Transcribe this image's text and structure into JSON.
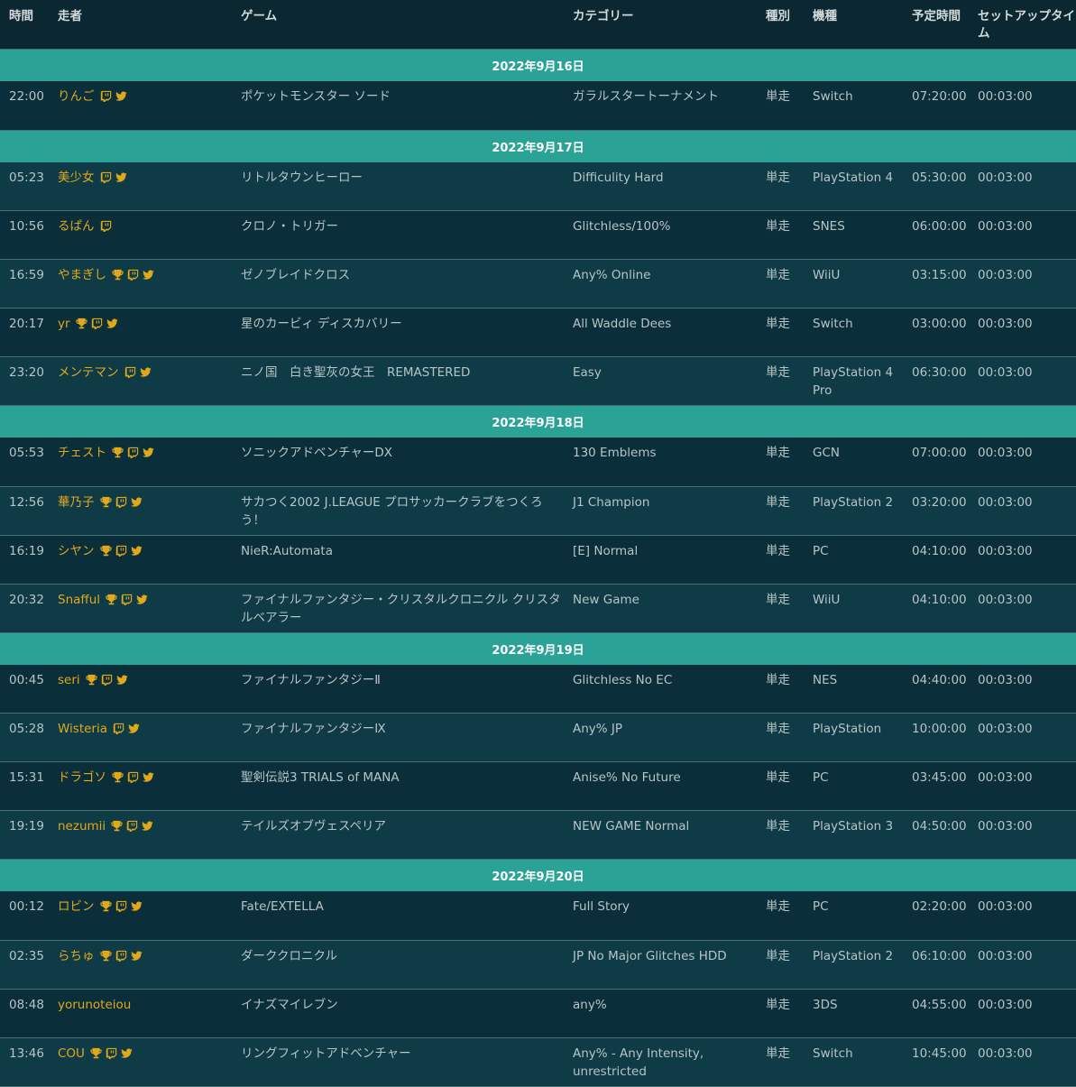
{
  "headers": {
    "time": "時間",
    "runner": "走者",
    "game": "ゲーム",
    "category": "カテゴリー",
    "type": "種別",
    "platform": "機種",
    "estimate": "予定時間",
    "setup": "セットアップタイム"
  },
  "icon_names": {
    "trophy": "trophy-icon",
    "twitch": "twitch-icon",
    "twitter": "twitter-icon"
  },
  "colors": {
    "day_header": "#2aa296",
    "runner_link": "#e2a81c",
    "background": "#0a2f3a"
  },
  "days": [
    {
      "label": "2022年9月16日",
      "runs": [
        {
          "time": "22:00",
          "runner": "りんご",
          "icons": [
            "twitch",
            "twitter"
          ],
          "game": "ポケットモンスター ソード",
          "category": "ガラルスタートーナメント",
          "type": "単走",
          "platform": "Switch",
          "estimate": "07:20:00",
          "setup": "00:03:00"
        }
      ]
    },
    {
      "label": "2022年9月17日",
      "runs": [
        {
          "time": "05:23",
          "runner": "美少女",
          "icons": [
            "twitch",
            "twitter"
          ],
          "game": "リトルタウンヒーロー",
          "category": "Difficulity Hard",
          "type": "単走",
          "platform": "PlayStation 4",
          "estimate": "05:30:00",
          "setup": "00:03:00"
        },
        {
          "time": "10:56",
          "runner": "るぱん",
          "icons": [
            "twitch"
          ],
          "game": "クロノ・トリガー",
          "category": "Glitchless/100%",
          "type": "単走",
          "platform": "SNES",
          "estimate": "06:00:00",
          "setup": "00:03:00"
        },
        {
          "time": "16:59",
          "runner": "やまぎし",
          "icons": [
            "trophy",
            "twitch",
            "twitter"
          ],
          "game": "ゼノブレイドクロス",
          "category": "Any% Online",
          "type": "単走",
          "platform": "WiiU",
          "estimate": "03:15:00",
          "setup": "00:03:00"
        },
        {
          "time": "20:17",
          "runner": "yr",
          "icons": [
            "trophy",
            "twitch",
            "twitter"
          ],
          "game": "星のカービィ ディスカバリー",
          "category": "All Waddle Dees",
          "type": "単走",
          "platform": "Switch",
          "estimate": "03:00:00",
          "setup": "00:03:00"
        },
        {
          "time": "23:20",
          "runner": "メンテマン",
          "icons": [
            "twitch",
            "twitter"
          ],
          "game": "ニノ国　白き聖灰の女王　REMASTERED",
          "category": "Easy",
          "type": "単走",
          "platform": "PlayStation 4 Pro",
          "estimate": "06:30:00",
          "setup": "00:03:00"
        }
      ]
    },
    {
      "label": "2022年9月18日",
      "runs": [
        {
          "time": "05:53",
          "runner": "チェスト",
          "icons": [
            "trophy",
            "twitch",
            "twitter"
          ],
          "game": "ソニックアドベンチャーDX",
          "category": "130 Emblems",
          "type": "単走",
          "platform": "GCN",
          "estimate": "07:00:00",
          "setup": "00:03:00"
        },
        {
          "time": "12:56",
          "runner": "華乃子",
          "icons": [
            "trophy",
            "twitch",
            "twitter"
          ],
          "game": "サカつく2002 J.LEAGUE プロサッカークラブをつくろう！",
          "category": "J1 Champion",
          "type": "単走",
          "platform": "PlayStation 2",
          "estimate": "03:20:00",
          "setup": "00:03:00"
        },
        {
          "time": "16:19",
          "runner": "シヤン",
          "icons": [
            "trophy",
            "twitch",
            "twitter"
          ],
          "game": "NieR:Automata",
          "category": "[E] Normal",
          "type": "単走",
          "platform": "PC",
          "estimate": "04:10:00",
          "setup": "00:03:00"
        },
        {
          "time": "20:32",
          "runner": "Snafful",
          "icons": [
            "trophy",
            "twitch",
            "twitter"
          ],
          "game": "ファイナルファンタジー・クリスタルクロニクル クリスタルベアラー",
          "category": "New Game",
          "type": "単走",
          "platform": "WiiU",
          "estimate": "04:10:00",
          "setup": "00:03:00"
        }
      ]
    },
    {
      "label": "2022年9月19日",
      "runs": [
        {
          "time": "00:45",
          "runner": "seri",
          "icons": [
            "trophy",
            "twitch",
            "twitter"
          ],
          "game": "ファイナルファンタジーⅡ",
          "category": "Glitchless No EC",
          "type": "単走",
          "platform": "NES",
          "estimate": "04:40:00",
          "setup": "00:03:00"
        },
        {
          "time": "05:28",
          "runner": "Wisteria",
          "icons": [
            "twitch",
            "twitter"
          ],
          "game": "ファイナルファンタジーⅨ",
          "category": "Any% JP",
          "type": "単走",
          "platform": "PlayStation",
          "estimate": "10:00:00",
          "setup": "00:03:00"
        },
        {
          "time": "15:31",
          "runner": "ドラゴソ",
          "icons": [
            "trophy",
            "twitch",
            "twitter"
          ],
          "game": "聖剣伝説3 TRIALS of MANA",
          "category": "Anise% No Future",
          "type": "単走",
          "platform": "PC",
          "estimate": "03:45:00",
          "setup": "00:03:00"
        },
        {
          "time": "19:19",
          "runner": "nezumii",
          "icons": [
            "trophy",
            "twitch",
            "twitter"
          ],
          "game": "テイルズオブヴェスペリア",
          "category": "NEW GAME Normal",
          "type": "単走",
          "platform": "PlayStation 3",
          "estimate": "04:50:00",
          "setup": "00:03:00"
        }
      ]
    },
    {
      "label": "2022年9月20日",
      "runs": [
        {
          "time": "00:12",
          "runner": "ロビン",
          "icons": [
            "trophy",
            "twitch",
            "twitter"
          ],
          "game": "Fate/EXTELLA",
          "category": "Full Story",
          "type": "単走",
          "platform": "PC",
          "estimate": "02:20:00",
          "setup": "00:03:00"
        },
        {
          "time": "02:35",
          "runner": "らちゅ",
          "icons": [
            "trophy",
            "twitch",
            "twitter"
          ],
          "game": "ダーククロニクル",
          "category": "JP No Major Glitches HDD",
          "type": "単走",
          "platform": "PlayStation 2",
          "estimate": "06:10:00",
          "setup": "00:03:00"
        },
        {
          "time": "08:48",
          "runner": "yorunoteiou",
          "icons": [],
          "game": "イナズマイレブン",
          "category": "any%",
          "type": "単走",
          "platform": "3DS",
          "estimate": "04:55:00",
          "setup": "00:03:00"
        },
        {
          "time": "13:46",
          "runner": "COU",
          "icons": [
            "trophy",
            "twitch",
            "twitter"
          ],
          "game": "リングフィットアドベンチャー",
          "category": "Any% - Any Intensity, unrestricted",
          "type": "単走",
          "platform": "Switch",
          "estimate": "10:45:00",
          "setup": "00:03:00"
        }
      ]
    }
  ]
}
